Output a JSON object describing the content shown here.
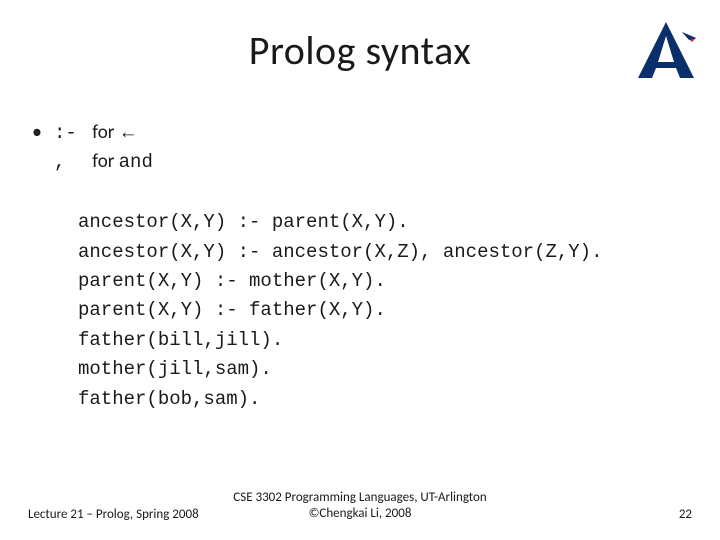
{
  "title": "Prolog syntax",
  "logo_name": "uta-logo",
  "bullets": {
    "line1_symbol": ":-",
    "line1_for": "for",
    "line1_arrow": "←",
    "line2_symbol": ",",
    "line2_for": "for",
    "line2_and": "and"
  },
  "code": "ancestor(X,Y) :- parent(X,Y).\nancestor(X,Y) :- ancestor(X,Z), ancestor(Z,Y).\nparent(X,Y) :- mother(X,Y).\nparent(X,Y) :- father(X,Y).\nfather(bill,jill).\nmother(jill,sam).\nfather(bob,sam).",
  "footer": {
    "left": "Lecture 21 – Prolog, Spring 2008",
    "center_line1": "CSE 3302 Programming Languages, UT-Arlington",
    "center_line2": "©Chengkai Li, 2008",
    "right": "22"
  }
}
